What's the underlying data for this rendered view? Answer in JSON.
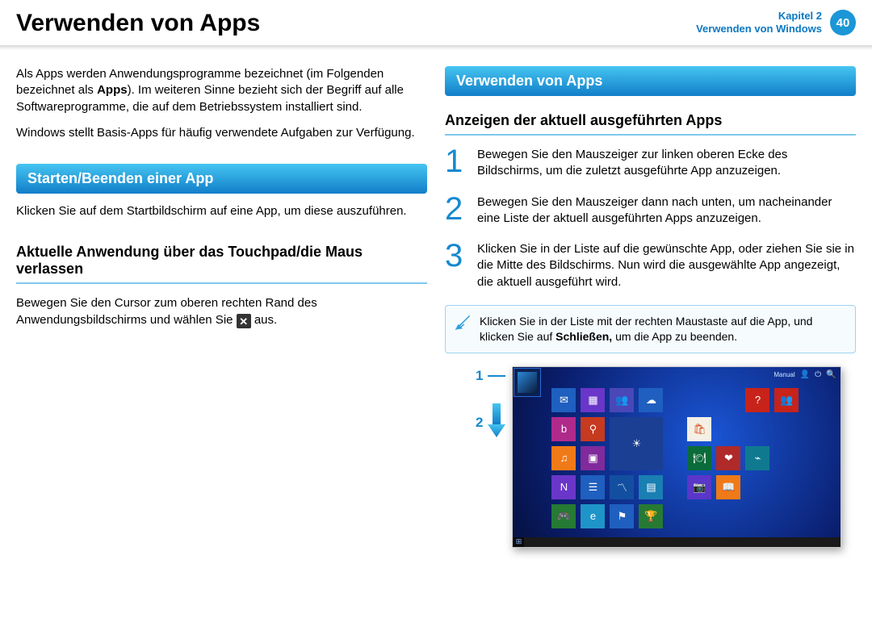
{
  "header": {
    "title": "Verwenden von Apps",
    "chapter_line1": "Kapitel 2",
    "chapter_line2": "Verwenden von Windows",
    "page_number": "40"
  },
  "left": {
    "intro_pre": "Als Apps werden Anwendungsprogramme bezeichnet (im Folgenden bezeichnet als ",
    "intro_bold": "Apps",
    "intro_post": "). Im weiteren Sinne bezieht sich der Begriff auf alle Softwareprogramme, die auf dem Betriebssystem installiert sind.",
    "intro2": "Windows stellt Basis-Apps für häufig verwendete Aufgaben zur Verfügung.",
    "banner": "Starten/Beenden einer App",
    "p_start": "Klicken Sie auf dem Startbildschirm auf eine App, um diese auszuführen.",
    "sub1": "Aktuelle Anwendung über das Touchpad/die Maus verlassen",
    "p_close_pre": "Bewegen Sie den Cursor zum oberen rechten Rand des Anwendungsbildschirms und wählen Sie ",
    "p_close_post": " aus.",
    "close_glyph": "✕"
  },
  "right": {
    "banner": "Verwenden von Apps",
    "sub1": "Anzeigen der aktuell ausgeführten Apps",
    "step1": "Bewegen Sie den Mauszeiger zur linken oberen Ecke des Bildschirms, um die zuletzt ausgeführte App anzuzeigen.",
    "step2": "Bewegen Sie den Mauszeiger dann nach unten, um nacheinander eine Liste der aktuell ausgeführten Apps anzuzeigen.",
    "step3": "Klicken Sie in der Liste auf die gewünschte App, oder ziehen Sie sie in die Mitte des Bildschirms. Nun wird die ausgewählte App angezeigt, die aktuell ausgeführt wird.",
    "note_pre": "Klicken Sie in der Liste mit der rechten Maustaste auf die App, und klicken Sie auf ",
    "note_bold": "Schließen,",
    "note_post": " um die App zu beenden.",
    "nums": {
      "n1": "1",
      "n2": "2",
      "n3": "3"
    },
    "label1": "1",
    "label2": "2",
    "shot": {
      "user": "Manual"
    }
  }
}
